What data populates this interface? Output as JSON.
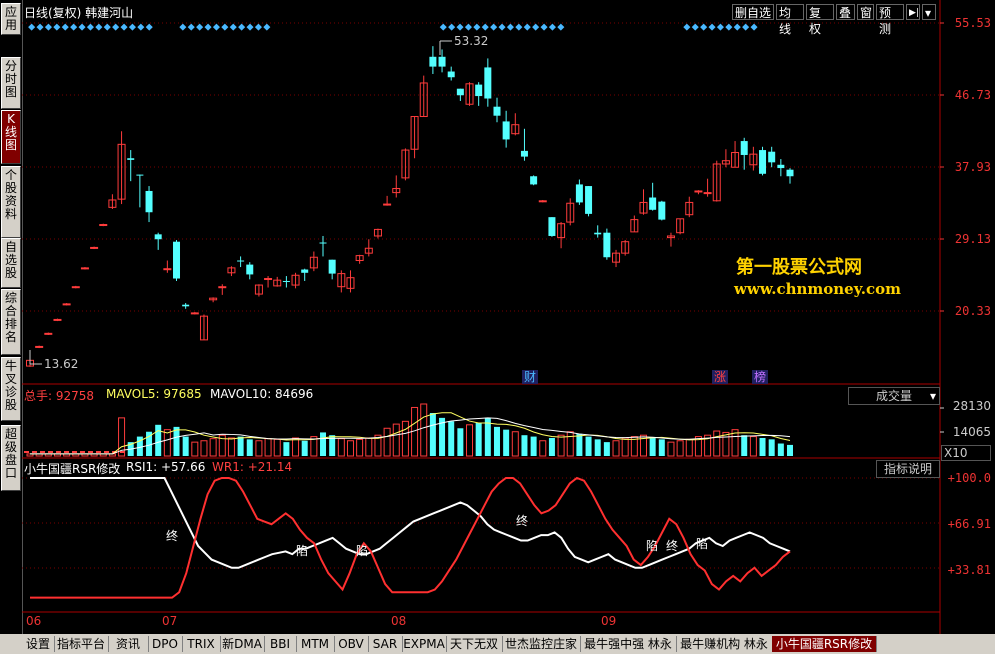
{
  "title": "日线(复权)  韩建河山",
  "top_buttons": [
    "删自选",
    "均线",
    "复权",
    "叠",
    "窗",
    "预测"
  ],
  "side_tabs": [
    {
      "label": "应用",
      "active": false
    },
    {
      "label": "分时图",
      "active": false
    },
    {
      "label": "K线图",
      "active": true
    },
    {
      "label": "个股资料",
      "active": false
    },
    {
      "label": "自选股",
      "active": false
    },
    {
      "label": "综合排名",
      "active": false
    },
    {
      "label": "牛叉诊股",
      "active": false
    },
    {
      "label": "超级盘口",
      "active": false
    }
  ],
  "price_axis": [
    "55.53",
    "46.73",
    "37.93",
    "29.13",
    "20.33"
  ],
  "price_high_label": "53.32",
  "price_low_label": "13.62",
  "event_markers": [
    "财",
    "涨",
    "榜"
  ],
  "watermark": {
    "cn": "第一股票公式网",
    "url": "www.chnmoney.com"
  },
  "volume_panel": {
    "total_label": "总手: 92758",
    "ma5_label": "MAVOL5: 97685",
    "ma10_label": "MAVOL10: 84696",
    "dropdown": "成交量",
    "axis": [
      "28130",
      "14065"
    ],
    "unit": "X10"
  },
  "indicator_panel": {
    "name": "小牛国疆RSR修改",
    "rsi_label": "RSI1: +57.66",
    "wr_label": "WR1: +21.14",
    "help_button": "指标说明",
    "axis": [
      "+100.0",
      "+66.91",
      "+33.81"
    ],
    "markers": [
      "终",
      "陷",
      "陷",
      "终",
      "陷",
      "终",
      "陷"
    ]
  },
  "x_axis": [
    "06",
    "07",
    "08",
    "09"
  ],
  "bottom_tabs": [
    "设置",
    "指标平台",
    "资讯",
    "DPO",
    "TRIX",
    "新DMA",
    "BBI",
    "MTM",
    "OBV",
    "SAR",
    "EXPMA",
    "天下无双",
    "世杰监控庄家",
    "最牛强中强 林永",
    "最牛赚机构 林永",
    "小牛国疆RSR修改"
  ],
  "colors": {
    "up": "#ff3c3c",
    "down": "#54ffff",
    "axis": "#e33",
    "rsi": "#ffffff",
    "wr": "#ff3030"
  },
  "chart_data": {
    "type": "candlestick",
    "price_axis_ticks": [
      55.53,
      46.73,
      37.93,
      29.13,
      20.33
    ],
    "max_label": 53.32,
    "min_label": 13.62,
    "candles": [
      [
        13.6,
        14.3,
        13.5,
        14.6,
        1
      ],
      [
        15.9,
        16.0,
        15.8,
        16.1,
        1
      ],
      [
        17.5,
        17.6,
        17.4,
        17.7,
        1
      ],
      [
        19.2,
        19.3,
        19.1,
        19.4,
        1
      ],
      [
        21.1,
        21.2,
        21.0,
        21.3,
        1
      ],
      [
        23.2,
        23.3,
        23.1,
        23.4,
        1
      ],
      [
        25.5,
        25.6,
        25.4,
        25.7,
        1
      ],
      [
        28.0,
        28.1,
        27.9,
        28.2,
        1
      ],
      [
        30.8,
        30.9,
        30.7,
        31.0,
        1
      ],
      [
        33.0,
        33.9,
        32.8,
        34.6,
        1
      ],
      [
        34.0,
        40.7,
        33.4,
        42.3,
        1
      ],
      [
        39.0,
        38.8,
        36.2,
        40.0,
        0
      ],
      [
        37.0,
        36.9,
        33.0,
        37.0,
        0
      ],
      [
        35.0,
        32.4,
        31.2,
        35.6,
        0
      ],
      [
        29.7,
        29.1,
        27.8,
        29.9,
        0
      ],
      [
        25.4,
        25.5,
        25.0,
        26.5,
        1
      ],
      [
        28.8,
        24.3,
        24.0,
        29.0,
        0
      ],
      [
        21.1,
        20.9,
        20.6,
        21.3,
        0
      ],
      [
        20.0,
        20.1,
        19.9,
        20.2,
        1
      ],
      [
        16.8,
        19.7,
        16.8,
        19.9,
        1
      ],
      [
        21.7,
        21.9,
        21.4,
        22.0,
        1
      ],
      [
        23.2,
        23.3,
        22.3,
        23.6,
        1
      ],
      [
        25.0,
        25.6,
        24.6,
        25.8,
        1
      ],
      [
        26.5,
        26.5,
        25.7,
        27.0,
        0
      ],
      [
        26.0,
        24.8,
        24.2,
        26.3,
        0
      ],
      [
        22.4,
        23.5,
        22.1,
        23.6,
        1
      ],
      [
        24.2,
        24.3,
        23.2,
        24.6,
        1
      ],
      [
        23.4,
        24.1,
        23.3,
        24.5,
        1
      ],
      [
        24.0,
        23.9,
        23.2,
        24.6,
        0
      ],
      [
        23.5,
        24.7,
        23.1,
        25.0,
        1
      ],
      [
        25.4,
        25.0,
        24.0,
        25.5,
        0
      ],
      [
        25.6,
        26.9,
        25.2,
        27.6,
        1
      ],
      [
        28.7,
        28.7,
        27.0,
        29.5,
        0
      ],
      [
        26.6,
        24.9,
        24.2,
        26.6,
        0
      ],
      [
        23.3,
        24.9,
        22.6,
        25.3,
        1
      ],
      [
        23.1,
        24.4,
        22.6,
        25.3,
        1
      ],
      [
        26.5,
        27.1,
        26.1,
        27.2,
        1
      ],
      [
        27.4,
        28.0,
        27.0,
        29.1,
        1
      ],
      [
        29.5,
        30.3,
        29.2,
        30.4,
        1
      ],
      [
        33.3,
        33.4,
        33.2,
        34.4,
        1
      ],
      [
        34.8,
        35.3,
        34.2,
        36.9,
        1
      ],
      [
        36.6,
        40.0,
        36.3,
        40.2,
        1
      ],
      [
        40.1,
        44.1,
        39.0,
        44.1,
        1
      ],
      [
        44.1,
        48.2,
        44.1,
        49.1,
        1
      ],
      [
        50.2,
        51.4,
        49.3,
        52.7,
        0
      ],
      [
        51.4,
        50.2,
        49.5,
        52.3,
        0
      ],
      [
        49.6,
        48.9,
        48.5,
        50.2,
        0
      ],
      [
        47.5,
        46.7,
        46.0,
        47.5,
        0
      ],
      [
        45.6,
        48.1,
        45.4,
        48.3,
        1
      ],
      [
        48.0,
        46.6,
        45.4,
        48.3,
        0
      ],
      [
        50.1,
        46.3,
        45.3,
        51.2,
        0
      ],
      [
        45.3,
        44.2,
        43.4,
        46.4,
        0
      ],
      [
        43.5,
        41.3,
        40.3,
        44.8,
        0
      ],
      [
        43.1,
        42.0,
        41.8,
        44.5,
        1
      ],
      [
        39.9,
        39.2,
        38.7,
        42.6,
        0
      ],
      [
        36.8,
        35.8,
        35.7,
        36.9,
        0
      ],
      [
        33.8,
        33.7,
        33.6,
        33.9,
        1
      ],
      [
        31.8,
        29.5,
        29.4,
        31.8,
        0
      ],
      [
        29.3,
        31.0,
        28.0,
        31.2,
        1
      ],
      [
        31.2,
        33.5,
        30.8,
        34.1,
        1
      ],
      [
        35.8,
        33.6,
        33.3,
        36.4,
        0
      ],
      [
        35.6,
        32.2,
        31.9,
        35.6,
        0
      ],
      [
        29.7,
        29.9,
        29.3,
        30.8,
        0
      ],
      [
        29.9,
        26.9,
        26.6,
        30.4,
        0
      ],
      [
        26.3,
        27.4,
        25.7,
        27.8,
        1
      ],
      [
        27.4,
        28.8,
        27.1,
        29.0,
        1
      ],
      [
        30.0,
        31.5,
        30.0,
        32.0,
        1
      ],
      [
        32.3,
        33.6,
        32.1,
        35.2,
        1
      ],
      [
        34.2,
        32.7,
        32.6,
        36.0,
        0
      ],
      [
        33.7,
        31.5,
        31.4,
        33.8,
        0
      ],
      [
        29.3,
        29.5,
        28.2,
        29.9,
        1
      ],
      [
        29.9,
        31.6,
        29.7,
        31.6,
        1
      ],
      [
        32.1,
        33.6,
        31.8,
        34.3,
        1
      ],
      [
        35.0,
        35.0,
        34.6,
        35.1,
        1
      ],
      [
        34.7,
        34.8,
        34.3,
        36.5,
        1
      ],
      [
        33.8,
        38.3,
        33.7,
        38.7,
        1
      ],
      [
        38.7,
        38.3,
        37.9,
        40.1,
        1
      ],
      [
        37.9,
        39.7,
        37.9,
        41.1,
        1
      ],
      [
        41.1,
        39.4,
        37.6,
        41.5,
        0
      ],
      [
        39.5,
        38.2,
        37.5,
        40.4,
        1
      ],
      [
        40.0,
        37.1,
        36.9,
        40.4,
        0
      ],
      [
        39.8,
        38.5,
        37.9,
        40.4,
        0
      ],
      [
        37.8,
        38.2,
        36.8,
        38.9,
        0
      ],
      [
        37.6,
        36.8,
        35.9,
        37.8,
        0
      ]
    ],
    "volume_axis_ticks": [
      28130,
      14065
    ],
    "rsi_axis_ticks": [
      100.0,
      66.91,
      33.81
    ],
    "series": [
      {
        "name": "RSI1",
        "values": [
          100,
          100,
          100,
          100,
          100,
          100,
          100,
          100,
          100,
          100,
          100,
          100,
          100,
          100,
          100,
          100,
          100,
          100,
          100,
          100,
          100,
          90,
          80,
          70,
          60,
          50,
          45,
          40,
          38,
          36,
          34,
          34,
          36,
          38,
          40,
          42,
          44,
          45,
          46,
          44,
          48,
          48,
          50,
          52,
          54,
          56,
          52,
          48,
          46,
          44,
          44,
          46,
          48,
          52,
          56,
          60,
          64,
          68,
          70,
          72,
          74,
          76,
          78,
          80,
          82,
          80,
          76,
          72,
          66,
          62,
          60,
          58,
          56,
          54,
          54,
          56,
          58,
          58,
          60,
          56,
          48,
          42,
          40,
          38,
          40,
          42,
          44,
          40,
          38,
          36,
          34,
          34,
          36,
          38,
          40,
          42,
          44,
          46,
          48,
          52,
          54,
          56,
          52,
          50,
          54,
          56,
          58,
          60,
          58,
          56,
          52,
          50,
          48,
          46
        ]
      },
      {
        "name": "WR1",
        "values": [
          12,
          12,
          12,
          12,
          12,
          12,
          12,
          12,
          12,
          12,
          12,
          12,
          12,
          12,
          12,
          12,
          12,
          12,
          12,
          12,
          12,
          16,
          30,
          50,
          70,
          88,
          98,
          100,
          100,
          98,
          90,
          80,
          70,
          68,
          66,
          70,
          74,
          70,
          62,
          56,
          52,
          40,
          30,
          24,
          18,
          30,
          44,
          52,
          46,
          34,
          22,
          16,
          16,
          16,
          16,
          16,
          16,
          18,
          24,
          32,
          40,
          50,
          60,
          70,
          80,
          90,
          96,
          100,
          100,
          96,
          88,
          80,
          74,
          76,
          80,
          88,
          96,
          100,
          98,
          90,
          80,
          70,
          62,
          56,
          50,
          40,
          36,
          42,
          50,
          60,
          70,
          66,
          56,
          44,
          36,
          32,
          22,
          18,
          24,
          28,
          24,
          30,
          34,
          28,
          32,
          36,
          42,
          46
        ]
      }
    ],
    "x_ticks": [
      "06",
      "07",
      "08",
      "09"
    ]
  }
}
